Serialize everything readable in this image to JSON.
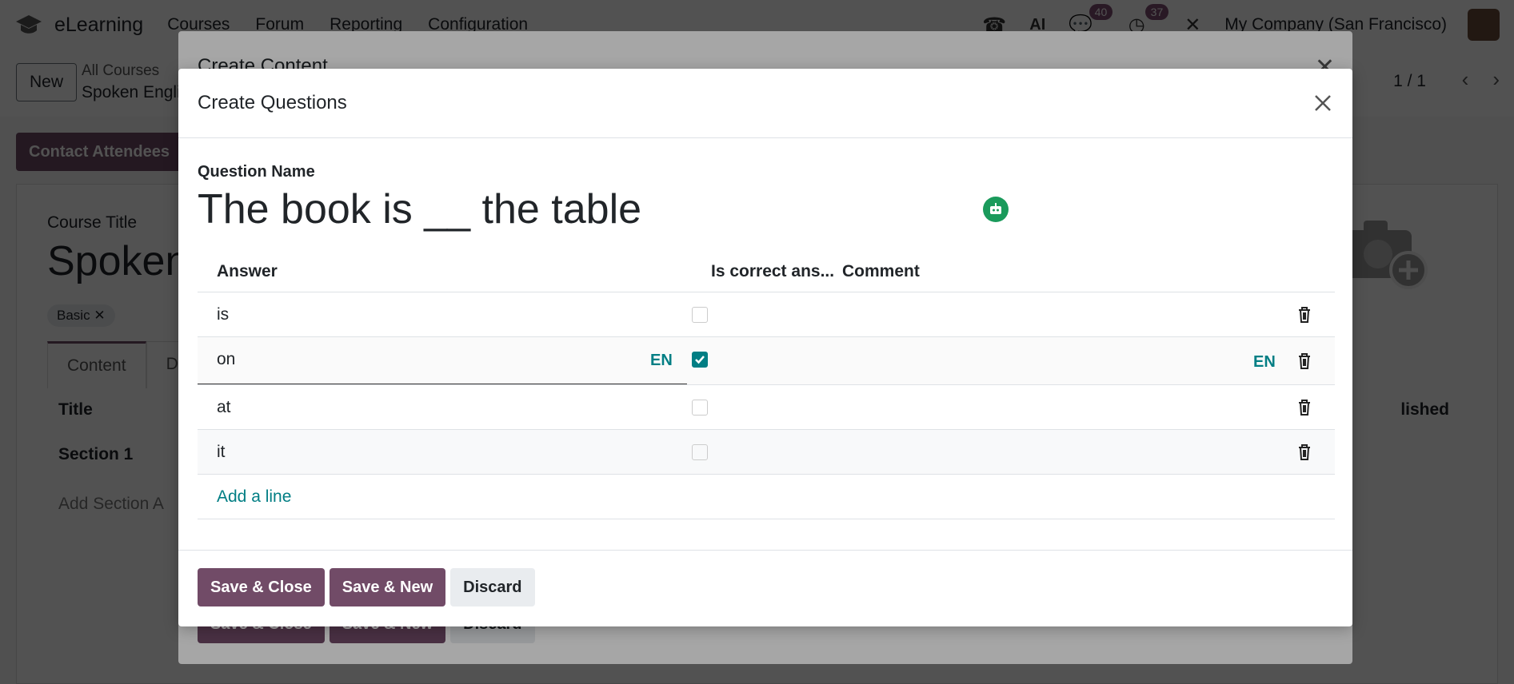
{
  "app": {
    "name": "eLearning",
    "menus": [
      "Courses",
      "Forum",
      "Reporting",
      "Configuration"
    ],
    "badges": {
      "messages": "40",
      "activities": "37"
    },
    "company": "My Company (San Francisco)",
    "ai_label": "AI"
  },
  "control": {
    "new_label": "New",
    "breadcrumb_parent": "All Courses",
    "breadcrumb_current": "Spoken Engli",
    "pager": "1 / 1"
  },
  "form": {
    "contact_attendees": "Contact Attendees",
    "course_title_label": "Course Title",
    "course_title": "Spoken",
    "tag": "Basic",
    "tabs": [
      "Content",
      "D"
    ],
    "col_title": "Title",
    "col_published": "lished",
    "section": "Section 1",
    "add_section": "Add Section  A"
  },
  "back_dialog": {
    "title": "Create Content",
    "buttons": {
      "save_close": "Save & Close",
      "save_new": "Save & New",
      "discard": "Discard"
    }
  },
  "dialog": {
    "title": "Create Questions",
    "question_label": "Question Name",
    "question_name": "The book is __ the table",
    "columns": {
      "answer": "Answer",
      "is_correct": "Is correct ans...",
      "comment": "Comment"
    },
    "answers": [
      {
        "text": "is",
        "correct": false
      },
      {
        "text": "on",
        "correct": true
      },
      {
        "text": "at",
        "correct": false
      },
      {
        "text": "it",
        "correct": false
      }
    ],
    "lang_tag": "EN",
    "add_line": "Add a line",
    "buttons": {
      "save_close": "Save & Close",
      "save_new": "Save & New",
      "discard": "Discard"
    }
  },
  "colors": {
    "primary": "#714b67",
    "accent": "#017e84",
    "ai": "#1a9a5b"
  }
}
